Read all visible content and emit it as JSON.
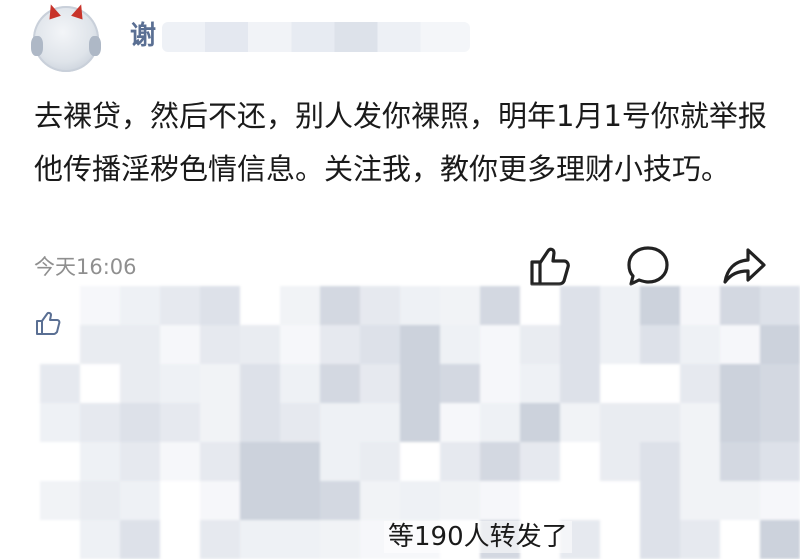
{
  "post": {
    "author_visible": "谢",
    "text": "去裸贷，然后不还，别人发你裸照，明年1月1号你就举报他传播淫秽色情信息。关注我，教你更多理财小技巧。",
    "timestamp": "今天16:06",
    "repost_summary": "等190人转发了"
  },
  "colors": {
    "username": "#5a6f93",
    "body_text": "#1a1a1a",
    "meta_text": "#8f8f8f",
    "icon_stroke": "#222222",
    "small_like_icon": "#5a6f93"
  },
  "icons": {
    "like": "thumbs-up-icon",
    "comment": "speech-bubble-icon",
    "share": "share-arrow-icon",
    "liked_by": "thumbs-up-icon"
  }
}
